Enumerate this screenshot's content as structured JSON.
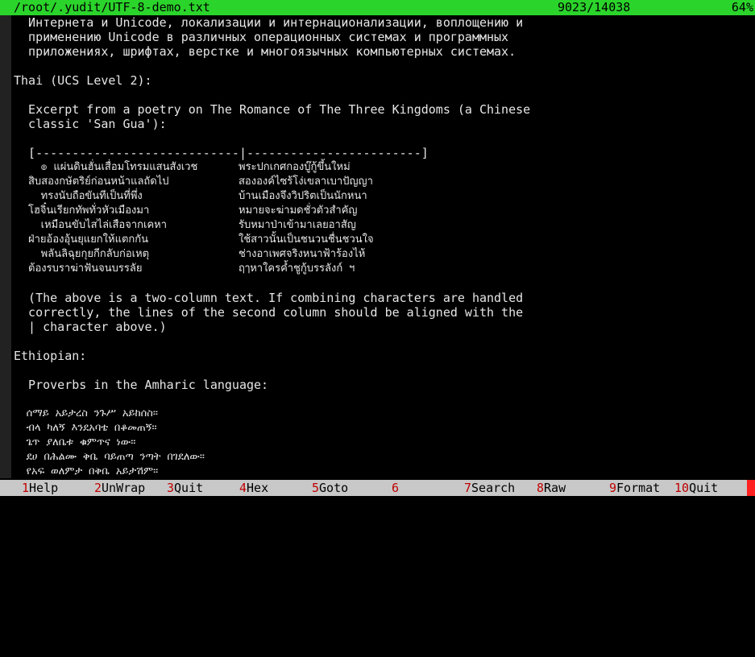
{
  "window": {
    "file_path": "/root/.yudit/UTF-8-demo.txt",
    "position": "9023/14038",
    "percent": "64%"
  },
  "colors": {
    "title_bg": "#2bd42b",
    "background": "#000000",
    "text": "#e6e6e6",
    "fkey_bg": "#c8c8c8",
    "fkey_number": "#c00000"
  },
  "text": {
    "russian_1": "  Интернета и Unicode, локализации и интернационализации, воплощению и",
    "russian_2": "  применению Unicode в различных операционных системах и программных",
    "russian_3": "  приложениях, шрифтах, верстке и многоязычных компьютерных системах.",
    "thai_heading": "Thai (UCS Level 2):",
    "excerpt_1": "  Excerpt from a poetry on The Romance of The Three Kingdoms (a Chinese",
    "excerpt_2": "  classic 'San Gua'):",
    "rule": "  [----------------------------|------------------------]",
    "thai_rows": [
      {
        "left": "  ๏ แผ่นดินฮั่นเสื่อมโทรมแสนสังเวช",
        "right": "พระปกเกศกองบู๊กู้ขึ้นใหม่"
      },
      {
        "left": "สิบสองกษัตริย์ก่อนหน้าแลถัดไป",
        "right": "สององค์ไซร้โง่เขลาเบาปัญญา"
      },
      {
        "left": "  ทรงนับถือขันทีเป็นที่พึ่ง",
        "right": "บ้านเมืองจึงวิปริตเป็นนักหนา"
      },
      {
        "left": "โฮจิ๋นเรียกทัพทั่วหัวเมืองมา",
        "right": "หมายจะฆ่ามดชั่วตัวสำคัญ"
      },
      {
        "left": "  เหมือนขับไสไล่เสือจากเคหา",
        "right": "รับหมาป่าเข้ามาเลยอาสัญ"
      },
      {
        "left": "ฝ่ายอ้องอุ้นยุแยกให้แตกกัน",
        "right": "ใช้สาวนั้นเป็นชนวนชื่นชวนใจ"
      },
      {
        "left": "  พลันลิฉุยกุยกีกลับก่อเหตุ",
        "right": "ช่างอาเพศจริงหนาฟ้าร้องไห้"
      },
      {
        "left": "ต้องรบราฆ่าฟันจนบรรลัย",
        "right": "ฤๅหาใครค้ำชูกู้บรรลังก์ ฯ"
      }
    ],
    "note_1": "  (The above is a two-column text. If combining characters are handled",
    "note_2": "  correctly, the lines of the second column should be aligned with the",
    "note_3": "  | character above.)",
    "ethiopian_heading": "Ethiopian:",
    "proverbs_heading": "  Proverbs in the Amharic language:",
    "amharic": [
      "  ሰማይ አይታረስ ንጉሥ አይከሰስ።",
      "  ብላ ካለኝ እንደአባቴ በቆመጠኝ።",
      "  ጌጥ ያለቤቱ ቁምጥና ነው።",
      "  ደሀ በሕልሙ ቅቤ ባይጠጣ ንጣት በገደለው።",
      "  የአፍ ወለምታ በቅቤ አይታሽም።"
    ]
  },
  "function_keys": [
    {
      "num": "1",
      "label": "Help"
    },
    {
      "num": "2",
      "label": "UnWrap"
    },
    {
      "num": "3",
      "label": "Quit"
    },
    {
      "num": "4",
      "label": "Hex"
    },
    {
      "num": "5",
      "label": "Goto"
    },
    {
      "num": "6",
      "label": ""
    },
    {
      "num": "7",
      "label": "Search"
    },
    {
      "num": "8",
      "label": "Raw"
    },
    {
      "num": "9",
      "label": "Format"
    },
    {
      "num": "10",
      "label": "Quit"
    }
  ]
}
